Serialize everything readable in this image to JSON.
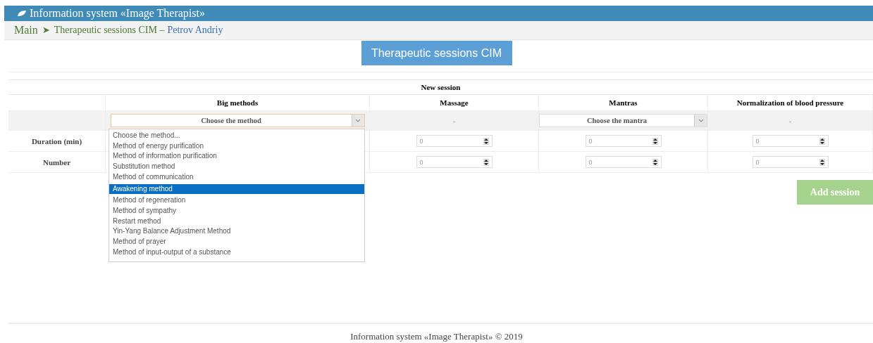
{
  "header": {
    "title": "Information system «Image Therapist»"
  },
  "breadcrumb": {
    "home": "Main",
    "separator": "➤",
    "section": "Therapeutic sessions CIM –",
    "user": "Petrov Andriy"
  },
  "page_title": "Therapeutic sessions CIM",
  "table": {
    "caption": "New session",
    "columns": [
      "Big methods",
      "Massage",
      "Mantras",
      "Normalization of blood pressure"
    ],
    "choice_row": [
      {
        "kind": "select",
        "value": "Choose the method",
        "open": true
      },
      {
        "kind": "dash",
        "text": "-"
      },
      {
        "kind": "select",
        "value": "Choose the mantra",
        "open": false
      },
      {
        "kind": "dash",
        "text": "-"
      }
    ],
    "rows": [
      {
        "label": "Duration (min)",
        "values": [
          "0",
          "0",
          "0"
        ]
      },
      {
        "label": "Number",
        "values": [
          "0",
          "0",
          "0"
        ]
      }
    ]
  },
  "method_options": [
    {
      "label": "Choose the method...",
      "selected": false
    },
    {
      "label": "Method of energy purification",
      "selected": false
    },
    {
      "label": "Method of information purification",
      "selected": false
    },
    {
      "label": "Substitution method",
      "selected": false
    },
    {
      "label": "Method of communication",
      "selected": false
    },
    {
      "label": "Awakening method",
      "selected": true
    },
    {
      "label": "Method of regeneration",
      "selected": false
    },
    {
      "label": "Method of sympathy",
      "selected": false
    },
    {
      "label": "Restart method",
      "selected": false
    },
    {
      "label": "Yin-Yang Balance Adjustment Method",
      "selected": false
    },
    {
      "label": "Method of prayer",
      "selected": false
    },
    {
      "label": "Method of input-output of a substance",
      "selected": false
    }
  ],
  "add_button": "Add session",
  "footer": "Information system «Image Therapist» © 2019"
}
